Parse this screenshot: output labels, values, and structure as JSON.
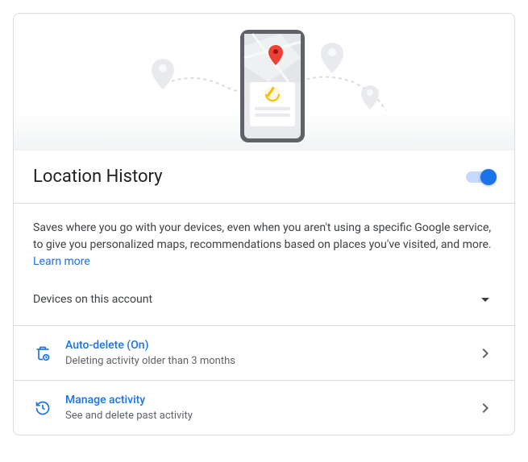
{
  "title": "Location History",
  "toggle_on": true,
  "description_text": "Saves where you go with your devices, even when you aren't using a specific Google service, to give you personalized maps, recommendations based on places you've visited, and more. ",
  "learn_more": "Learn more",
  "devices_label": "Devices on this account",
  "auto_delete": {
    "title": "Auto-delete (On)",
    "subtitle": "Deleting activity older than 3 months"
  },
  "manage_activity": {
    "title": "Manage activity",
    "subtitle": "See and delete past activity"
  },
  "colors": {
    "accent": "#1a73e8"
  }
}
